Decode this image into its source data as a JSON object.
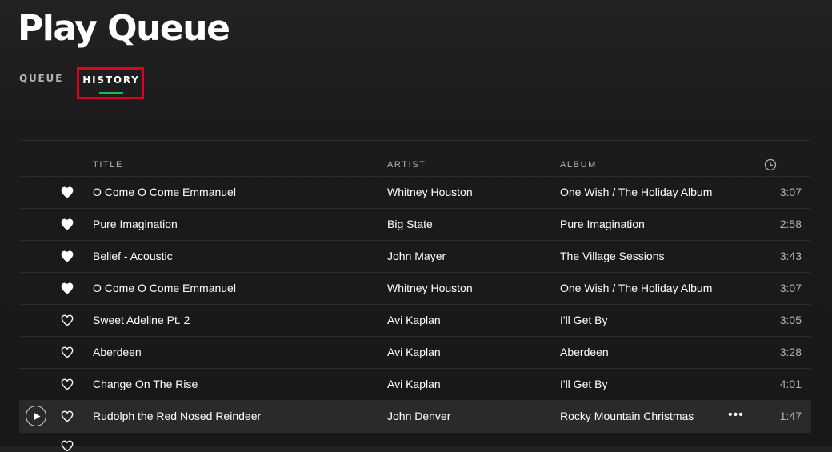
{
  "page": {
    "title": "Play Queue"
  },
  "tabs": [
    {
      "label": "QUEUE",
      "selected": false
    },
    {
      "label": "HISTORY",
      "selected": true
    }
  ],
  "colors": {
    "accent": "#1db954",
    "highlight_border": "#e3001b",
    "text_primary": "#ffffff",
    "text_secondary": "#b3b3b3"
  },
  "columns": {
    "title": "TITLE",
    "artist": "ARTIST",
    "album": "ALBUM",
    "duration_icon": "clock-icon"
  },
  "tracks": [
    {
      "title": "O Come O Come Emmanuel",
      "artist": "Whitney Houston",
      "album": "One Wish / The Holiday Album",
      "duration": "3:07",
      "liked": true
    },
    {
      "title": "Pure Imagination",
      "artist": "Big State",
      "album": "Pure Imagination",
      "duration": "2:58",
      "liked": true
    },
    {
      "title": "Belief - Acoustic",
      "artist": "John Mayer",
      "album": "The Village Sessions",
      "duration": "3:43",
      "liked": true
    },
    {
      "title": "O Come O Come Emmanuel",
      "artist": "Whitney Houston",
      "album": "One Wish / The Holiday Album",
      "duration": "3:07",
      "liked": true
    },
    {
      "title": "Sweet Adeline Pt. 2",
      "artist": "Avi Kaplan",
      "album": "I'll Get By",
      "duration": "3:05",
      "liked": false
    },
    {
      "title": "Aberdeen",
      "artist": "Avi Kaplan",
      "album": "Aberdeen",
      "duration": "3:28",
      "liked": false
    },
    {
      "title": "Change On The Rise",
      "artist": "Avi Kaplan",
      "album": "I'll Get By",
      "duration": "4:01",
      "liked": false
    },
    {
      "title": "Rudolph the Red Nosed Reindeer",
      "artist": "John Denver",
      "album": "Rocky Mountain Christmas",
      "duration": "1:47",
      "liked": false,
      "hovered": true
    }
  ],
  "row_actions": {
    "more_label": "•••",
    "play_icon": "play-icon",
    "heart_filled_icon": "heart-filled-icon",
    "heart_outline_icon": "heart-outline-icon"
  }
}
